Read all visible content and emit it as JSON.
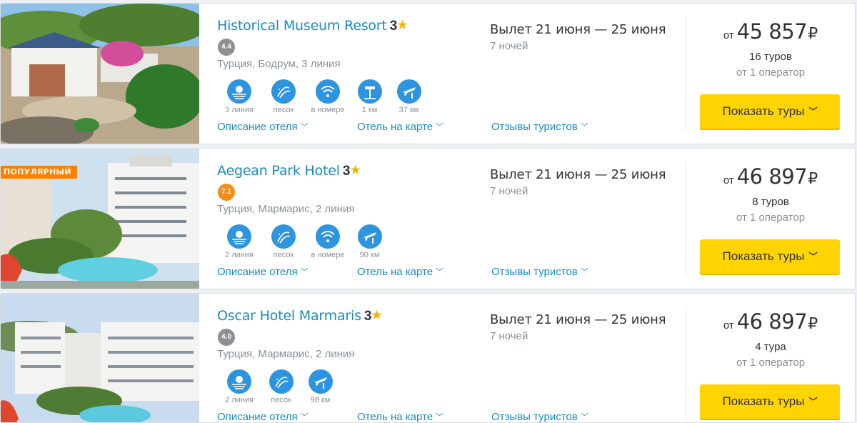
{
  "colors": {
    "link": "#1a8ac2",
    "button": "#ffd400",
    "popular": "#ff7f00",
    "icon_bg": "#2d95e0"
  },
  "hotels": [
    {
      "name": "Historical Museum Resort",
      "stars": "3",
      "rating": "4.4",
      "rating_color": "gray",
      "popular_badge": "",
      "location": "Турция, Бодрум, 3 линия",
      "amenities": [
        {
          "icon": "beach-line-icon",
          "label": "3 линия"
        },
        {
          "icon": "sand-icon",
          "label": "песок"
        },
        {
          "icon": "wifi-icon",
          "label": "в номере"
        },
        {
          "icon": "beach-distance-icon",
          "label": "1 км"
        },
        {
          "icon": "airport-icon",
          "label": "37 км"
        }
      ],
      "links": {
        "description": "Описание отеля",
        "map": "Отель на карте",
        "reviews": "Отзывы туристов"
      },
      "dates": "Вылет 21 июня — 25 июня",
      "nights": "7 ночей",
      "price_from": "от",
      "price": "45 857",
      "currency": "₽",
      "tours": "16 туров",
      "operators": "от 1 оператор",
      "button": "Показать туры"
    },
    {
      "name": "Aegean Park Hotel",
      "stars": "3",
      "rating": "7.1",
      "rating_color": "orange",
      "popular_badge": "ПОПУЛЯРНЫЙ",
      "location": "Турция, Мармарис, 2 линия",
      "amenities": [
        {
          "icon": "beach-line-icon",
          "label": "2 линия"
        },
        {
          "icon": "sand-icon",
          "label": "песок"
        },
        {
          "icon": "wifi-icon",
          "label": "в номере"
        },
        {
          "icon": "airport-icon",
          "label": "90 км"
        }
      ],
      "links": {
        "description": "Описание отеля",
        "map": "Отель на карте",
        "reviews": "Отзывы туристов"
      },
      "dates": "Вылет 21 июня — 25 июня",
      "nights": "7 ночей",
      "price_from": "от",
      "price": "46 897",
      "currency": "₽",
      "tours": "8 туров",
      "operators": "от 1 оператор",
      "button": "Показать туры"
    },
    {
      "name": "Oscar Hotel Marmaris",
      "stars": "3",
      "rating": "4.0",
      "rating_color": "gray",
      "popular_badge": "",
      "location": "Турция, Мармарис, 2 линия",
      "amenities": [
        {
          "icon": "beach-line-icon",
          "label": "2 линия"
        },
        {
          "icon": "sand-icon",
          "label": "песок"
        },
        {
          "icon": "airport-icon",
          "label": "98 км"
        }
      ],
      "links": {
        "description": "Описание отеля",
        "map": "Отель на карте",
        "reviews": "Отзывы туристов"
      },
      "dates": "Вылет 21 июня — 25 июня",
      "nights": "7 ночей",
      "price_from": "от",
      "price": "46 897",
      "currency": "₽",
      "tours": "4 тура",
      "operators": "от 1 оператор",
      "button": "Показать туры"
    }
  ]
}
